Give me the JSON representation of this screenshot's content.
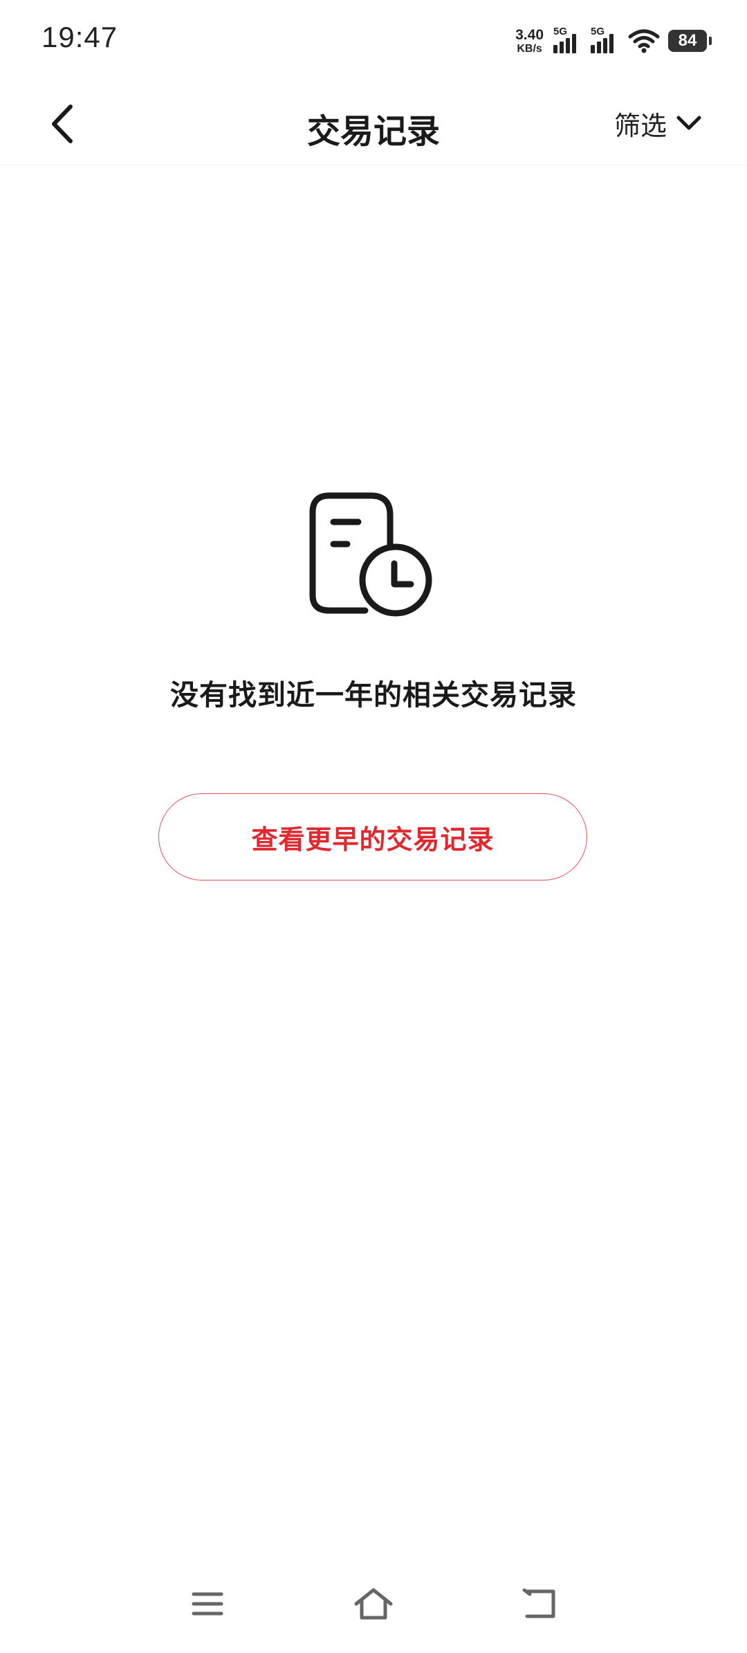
{
  "status_bar": {
    "time": "19:47",
    "net_speed_value": "3.40",
    "net_speed_unit": "KB/s",
    "sim1_tag": "5G",
    "sim2_tag": "5G",
    "battery": "84"
  },
  "header": {
    "title": "交易记录",
    "filter_label": "筛选"
  },
  "empty_state": {
    "icon": "record-clock-icon",
    "message": "没有找到近一年的相关交易记录",
    "button_label": "查看更早的交易记录"
  },
  "nav_bar": {
    "icons": [
      "menu-icon",
      "home-icon",
      "back-icon"
    ]
  },
  "colors": {
    "accent": "#e2282f",
    "text": "#1a1a1a",
    "background": "#ffffff"
  }
}
